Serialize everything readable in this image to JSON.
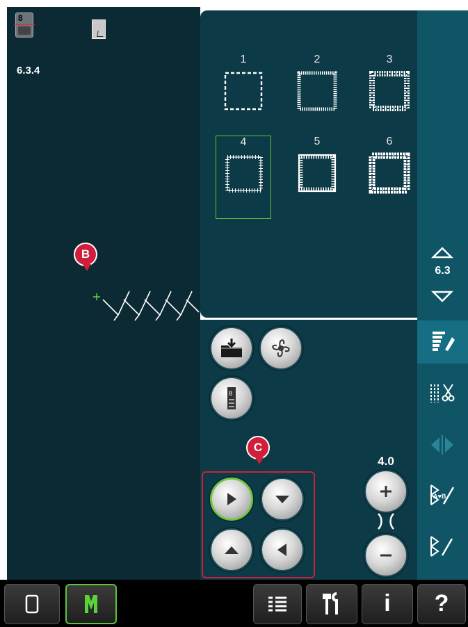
{
  "left_panel": {
    "presser_foot_label": "8",
    "stitch_number": "6.3.4"
  },
  "callouts": {
    "b": "B",
    "c": "C"
  },
  "stitch_grid": {
    "items": [
      {
        "number": "1",
        "name": "square-straight"
      },
      {
        "number": "2",
        "name": "square-zigzag"
      },
      {
        "number": "3",
        "name": "square-satin"
      },
      {
        "number": "4",
        "name": "square-feather",
        "selected": true
      },
      {
        "number": "5",
        "name": "square-ladder"
      },
      {
        "number": "6",
        "name": "square-decorative"
      }
    ]
  },
  "sidebar": {
    "page_number": "6.3",
    "buttons": [
      "stitch-menu-icon",
      "sewing-techniques-icon",
      "mirror-icon",
      "stitch-creator-icon",
      "sequence-icon"
    ]
  },
  "options": {
    "load_button": "folder-load-icon",
    "program_button": "flower-program-icon",
    "stitch_positioning_button": "foot-positioning-icon",
    "arrow_buttons": [
      "right",
      "down",
      "up",
      "left"
    ],
    "value": "4.0"
  },
  "bottom_bar": {
    "buttons": [
      "sewing-mode-icon",
      "embroidery-mode-icon",
      "menu-list-icon",
      "settings-icon",
      "info-icon",
      "help-icon"
    ],
    "info_label": "i",
    "help_label": "?"
  },
  "colors": {
    "dark_teal": "#0c3a47",
    "preview_bg": "#0c2a33",
    "sidebar": "#0f5566",
    "selection_green": "#6fbf3b",
    "callout_red": "#d01f3c"
  }
}
